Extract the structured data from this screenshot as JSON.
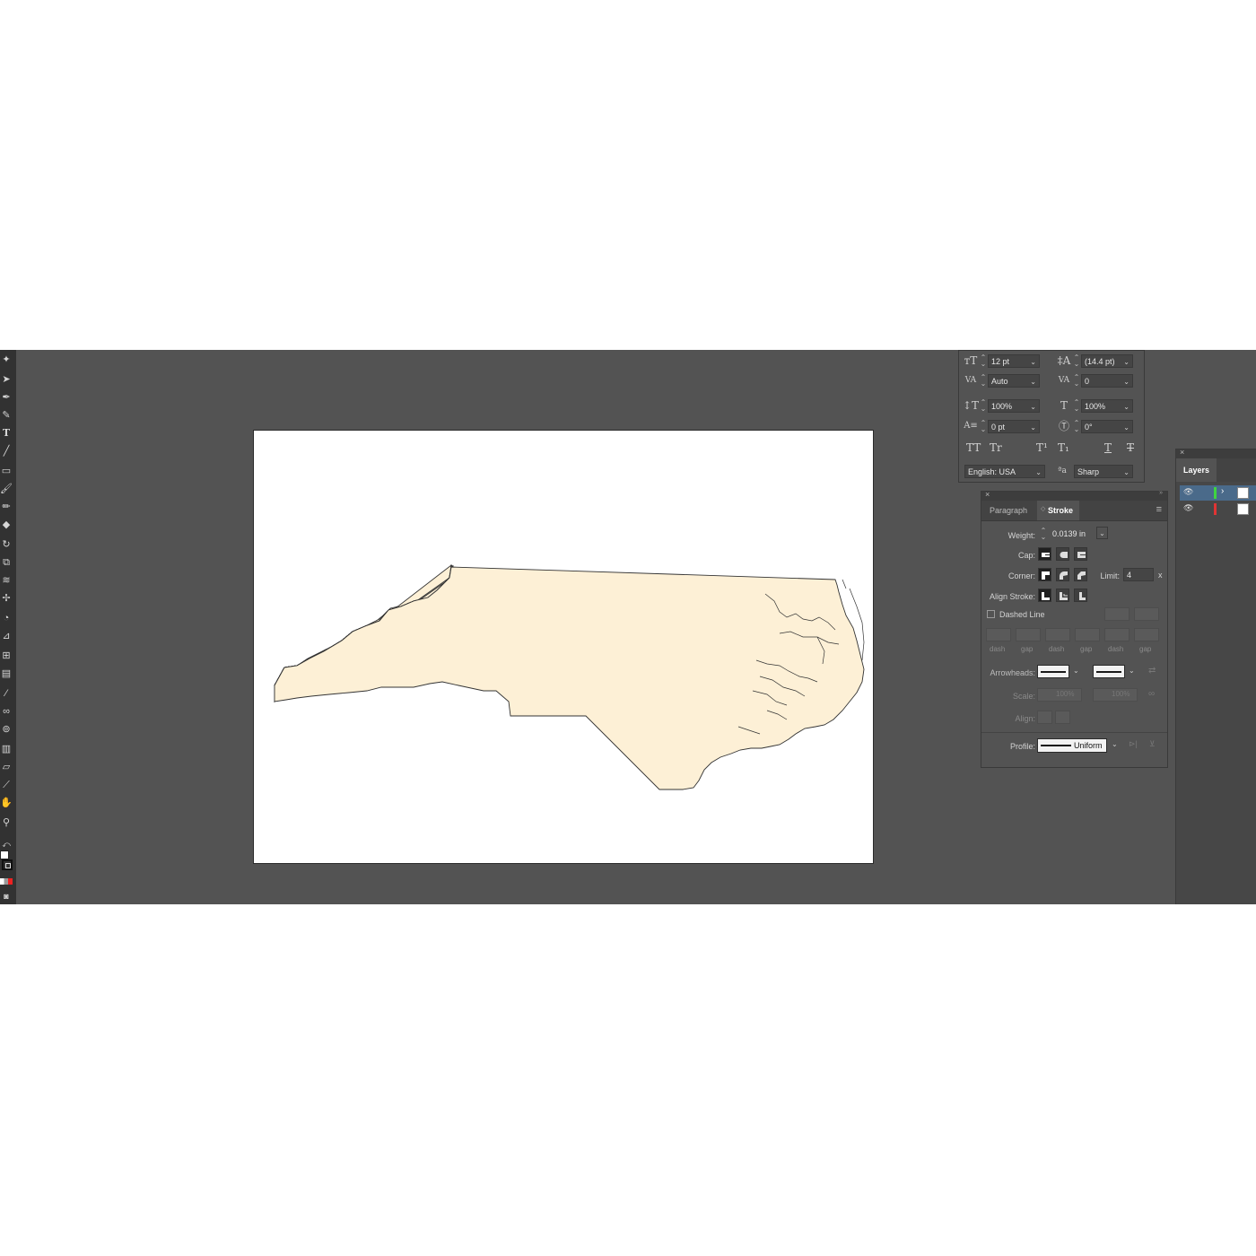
{
  "character": {
    "font_size": "12 pt",
    "leading": "(14.4 pt)",
    "kerning": "Auto",
    "tracking": "0",
    "vertical_scale": "100%",
    "horizontal_scale": "100%",
    "baseline_shift": "0 pt",
    "rotation": "0°",
    "language": "English: USA",
    "antialias": "Sharp",
    "style_buttons": [
      "TT",
      "Tr",
      "T¹",
      "T₁",
      "T",
      "T"
    ]
  },
  "stroke_panel": {
    "tabs": [
      {
        "label": "Paragraph",
        "active": false
      },
      {
        "label": "Stroke",
        "active": true
      }
    ],
    "weight_label": "Weight:",
    "weight_value": "0.0139 in",
    "cap_label": "Cap:",
    "corner_label": "Corner:",
    "limit_label": "Limit:",
    "limit_value": "4",
    "limit_unit": "x",
    "align_label": "Align Stroke:",
    "dashed_label": "Dashed Line",
    "dashed_checked": false,
    "dash_labels": [
      "dash",
      "gap",
      "dash",
      "gap",
      "dash",
      "gap"
    ],
    "arrowheads_label": "Arrowheads:",
    "scale_label": "Scale:",
    "scale_values": [
      "100%",
      "100%"
    ],
    "align_arrow_label": "Align:",
    "profile_label": "Profile:",
    "profile_value": "Uniform"
  },
  "layers_panel": {
    "title": "Layers",
    "layers": [
      {
        "color": "#3fd53f",
        "selected": true
      },
      {
        "color": "#e03434",
        "selected": false
      }
    ]
  },
  "colors": {
    "app_bg": "#535353",
    "panel_bg": "#535353",
    "map_fill": "#fdf0d6",
    "map_stroke": "#333333",
    "accent": "#4a6a8a"
  },
  "toolbar_tools": [
    "magic-wand",
    "direct-select",
    "pen",
    "curvature",
    "type",
    "line",
    "rectangle",
    "paintbrush",
    "pencil",
    "eraser",
    "rotate",
    "scale",
    "warp",
    "free-transform",
    "shape-builder",
    "perspective",
    "mesh",
    "gradient",
    "eyedropper",
    "blend",
    "symbol-sprayer",
    "column-graph",
    "artboard",
    "slice",
    "hand",
    "zoom"
  ]
}
